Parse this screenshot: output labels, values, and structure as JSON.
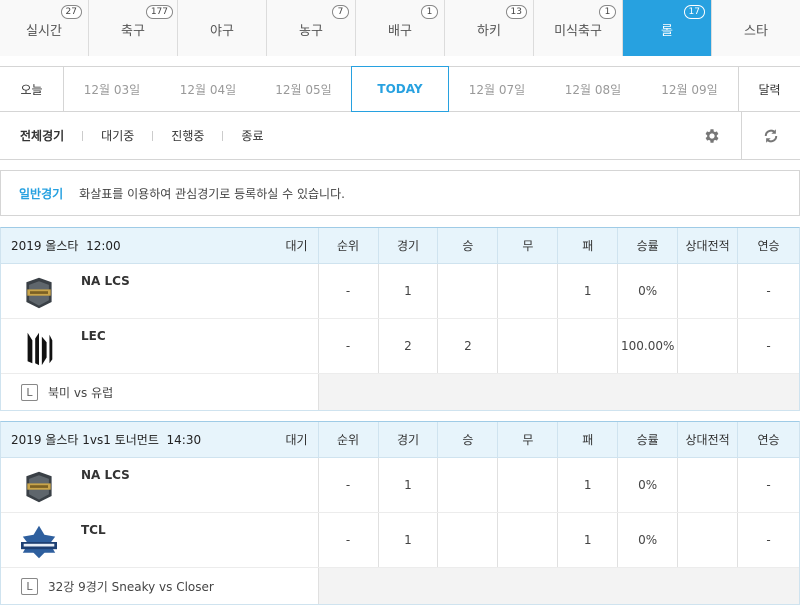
{
  "sport_tabs": [
    {
      "label": "실시간",
      "badge": "27"
    },
    {
      "label": "축구",
      "badge": "177"
    },
    {
      "label": "야구",
      "badge": ""
    },
    {
      "label": "농구",
      "badge": "7"
    },
    {
      "label": "배구",
      "badge": "1"
    },
    {
      "label": "하키",
      "badge": "13"
    },
    {
      "label": "미식축구",
      "badge": "1"
    },
    {
      "label": "롤",
      "badge": "17"
    },
    {
      "label": "스타",
      "badge": ""
    }
  ],
  "active_tab_color": "#27a1e0",
  "dates": {
    "today_label": "오늘",
    "items": [
      "12월 03일",
      "12월 04일",
      "12월 05일",
      "TODAY",
      "12월 07일",
      "12월 08일",
      "12월 09일"
    ],
    "calendar_label": "달력"
  },
  "filters": {
    "items": [
      "전체경기",
      "대기중",
      "진행중",
      "종료"
    ],
    "settings_icon": "gear-icon",
    "refresh_icon": "refresh-icon"
  },
  "notice": {
    "title": "일반경기",
    "text": "화살표를 이용하여 관심경기로 등록하실 수 있습니다."
  },
  "columns": [
    "순위",
    "경기",
    "승",
    "무",
    "패",
    "승률",
    "상대전적",
    "연승"
  ],
  "matches": [
    {
      "title": "2019 올스타  12:00",
      "status": "대기",
      "teams": [
        {
          "name": "NA LCS",
          "logo": "na-lcs-logo",
          "stats": [
            "-",
            "1",
            "",
            "",
            "1",
            "0%",
            "",
            "-"
          ]
        },
        {
          "name": "LEC",
          "logo": "lec-logo",
          "stats": [
            "-",
            "2",
            "2",
            "",
            "",
            "100.00%",
            "",
            "-"
          ]
        }
      ],
      "footer": "북미 vs 유럽"
    },
    {
      "title": "2019 올스타 1vs1 토너먼트  14:30",
      "status": "대기",
      "teams": [
        {
          "name": "NA LCS",
          "logo": "na-lcs-logo",
          "stats": [
            "-",
            "1",
            "",
            "",
            "1",
            "0%",
            "",
            "-"
          ]
        },
        {
          "name": "TCL",
          "logo": "tcl-logo",
          "stats": [
            "-",
            "1",
            "",
            "",
            "1",
            "0%",
            "",
            "-"
          ]
        }
      ],
      "footer": "32강 9경기 Sneaky vs Closer"
    }
  ]
}
